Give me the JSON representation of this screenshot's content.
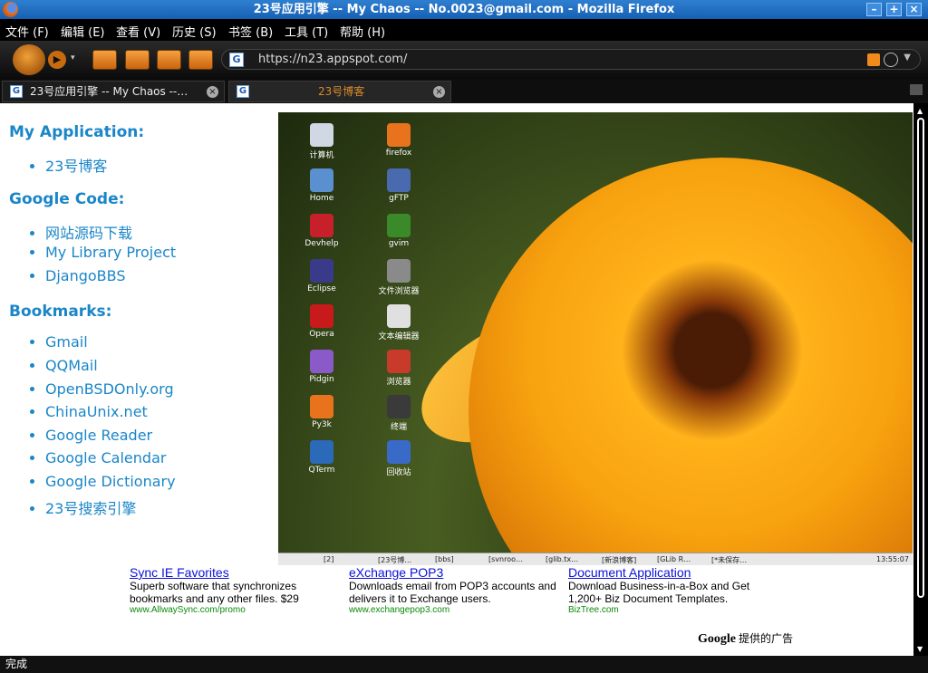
{
  "window": {
    "title": "23号应用引擎 -- My Chaos -- No.0023@gmail.com - Mozilla Firefox",
    "min": "–",
    "max": "+",
    "close": "×"
  },
  "menu": [
    "文件 (F)",
    "编辑 (E)",
    "查看 (V)",
    "历史 (S)",
    "书签 (B)",
    "工具 (T)",
    "帮助 (H)"
  ],
  "nav": {
    "url": "https://n23.appspot.com/",
    "favicon": "G"
  },
  "tabs": [
    {
      "label": "23号应用引擎 -- My Chaos --…"
    },
    {
      "label": "23号博客"
    }
  ],
  "sidebar": {
    "my_app": {
      "heading": "My Application:",
      "items": [
        "23号博客"
      ]
    },
    "google_code": {
      "heading": "Google Code:",
      "items": [
        "网站源码下载",
        "My Library Project",
        "DjangoBBS"
      ]
    },
    "bookmarks": {
      "heading": "Bookmarks:",
      "items": [
        "Gmail",
        "QQMail",
        "OpenBSDOnly.org",
        "ChinaUnix.net",
        "Google Reader",
        "Google Calendar",
        "Google Dictionary",
        "23号搜索引擎"
      ]
    }
  },
  "desktop": {
    "icons_left": [
      "计算机",
      "Home",
      "Devhelp",
      "Eclipse",
      "Opera",
      "Pidgin",
      "Py3k",
      "QTerm"
    ],
    "icons_right": [
      "firefox",
      "gFTP",
      "gvim",
      "文件浏览器",
      "文本编辑器",
      "浏览器",
      "终端",
      "回收站"
    ],
    "panel": [
      "[2]",
      "[23号博…",
      "[bbs]",
      "[svnroo…",
      "[glib.tx…",
      "[新浪博客]",
      "[GLib R…",
      "[*未保存…",
      "13:55:07"
    ]
  },
  "ads": [
    {
      "title": "Sync IE Favorites",
      "body": "Superb software that synchronizes bookmarks and any other files. $29",
      "url": "www.AllwaySync.com/promo"
    },
    {
      "title": "eXchange POP3",
      "body": "Downloads email from POP3 accounts and delivers it to Exchange users.",
      "url": "www.exchangepop3.com"
    },
    {
      "title": "Document Application",
      "body": "Download Business-in-a-Box and Get 1,200+ Biz Document Templates.",
      "url": "BizTree.com"
    }
  ],
  "ads_by": {
    "brand": "Google",
    "text": "提供的广告"
  },
  "status": "完成",
  "colors": {
    "link": "#1a86c8",
    "ad_title": "#0a12d8",
    "ad_url": "#0a8a0a",
    "titlebar": "#1660b4"
  }
}
